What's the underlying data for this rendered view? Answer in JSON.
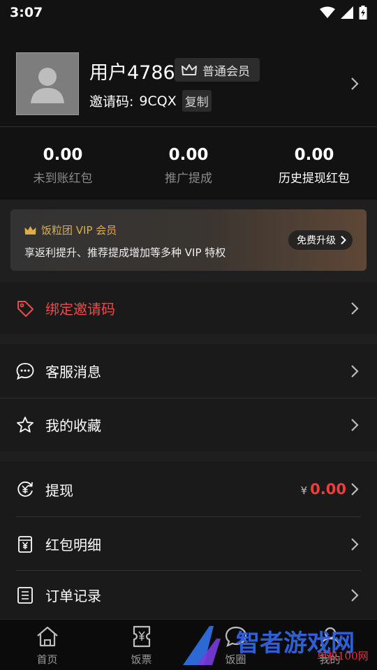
{
  "status_bar": {
    "time": "3:07",
    "icons": [
      "wifi-icon",
      "signal-icon",
      "battery-icon"
    ]
  },
  "profile": {
    "username": "用户4786",
    "member_level": "普通会员",
    "invite_label": "邀请码:",
    "invite_code": "9CQX",
    "copy_label": "复制"
  },
  "stats": [
    {
      "value": "0.00",
      "label": "未到账红包"
    },
    {
      "value": "0.00",
      "label": "推广提成"
    },
    {
      "value": "0.00",
      "label": "历史提现红包"
    }
  ],
  "vip": {
    "title": "饭粒团 VIP 会员",
    "description": "享返利提升、推荐提成增加等多种 VIP 特权",
    "upgrade_label": "免费升级"
  },
  "menu": {
    "bind_invite": "绑定邀请码",
    "customer_service": "客服消息",
    "favorites": "我的收藏",
    "withdraw": "提现",
    "withdraw_currency": "¥",
    "withdraw_amount": "0.00",
    "red_packet_detail": "红包明细",
    "order_records": "订单记录"
  },
  "bottom_nav": [
    {
      "label": "首页",
      "icon": "home-icon"
    },
    {
      "label": "饭票",
      "icon": "ticket-icon"
    },
    {
      "label": "饭圈",
      "icon": "chat-icon"
    },
    {
      "label": "我的",
      "icon": "profile-icon"
    }
  ],
  "watermark": {
    "text": "智者游戏网",
    "sub": "单机100网"
  },
  "colors": {
    "accent_red": "#ef4a4a",
    "vip_gold": "#e1ad47",
    "amount_red": "#f23c3c",
    "background": "#121212"
  }
}
